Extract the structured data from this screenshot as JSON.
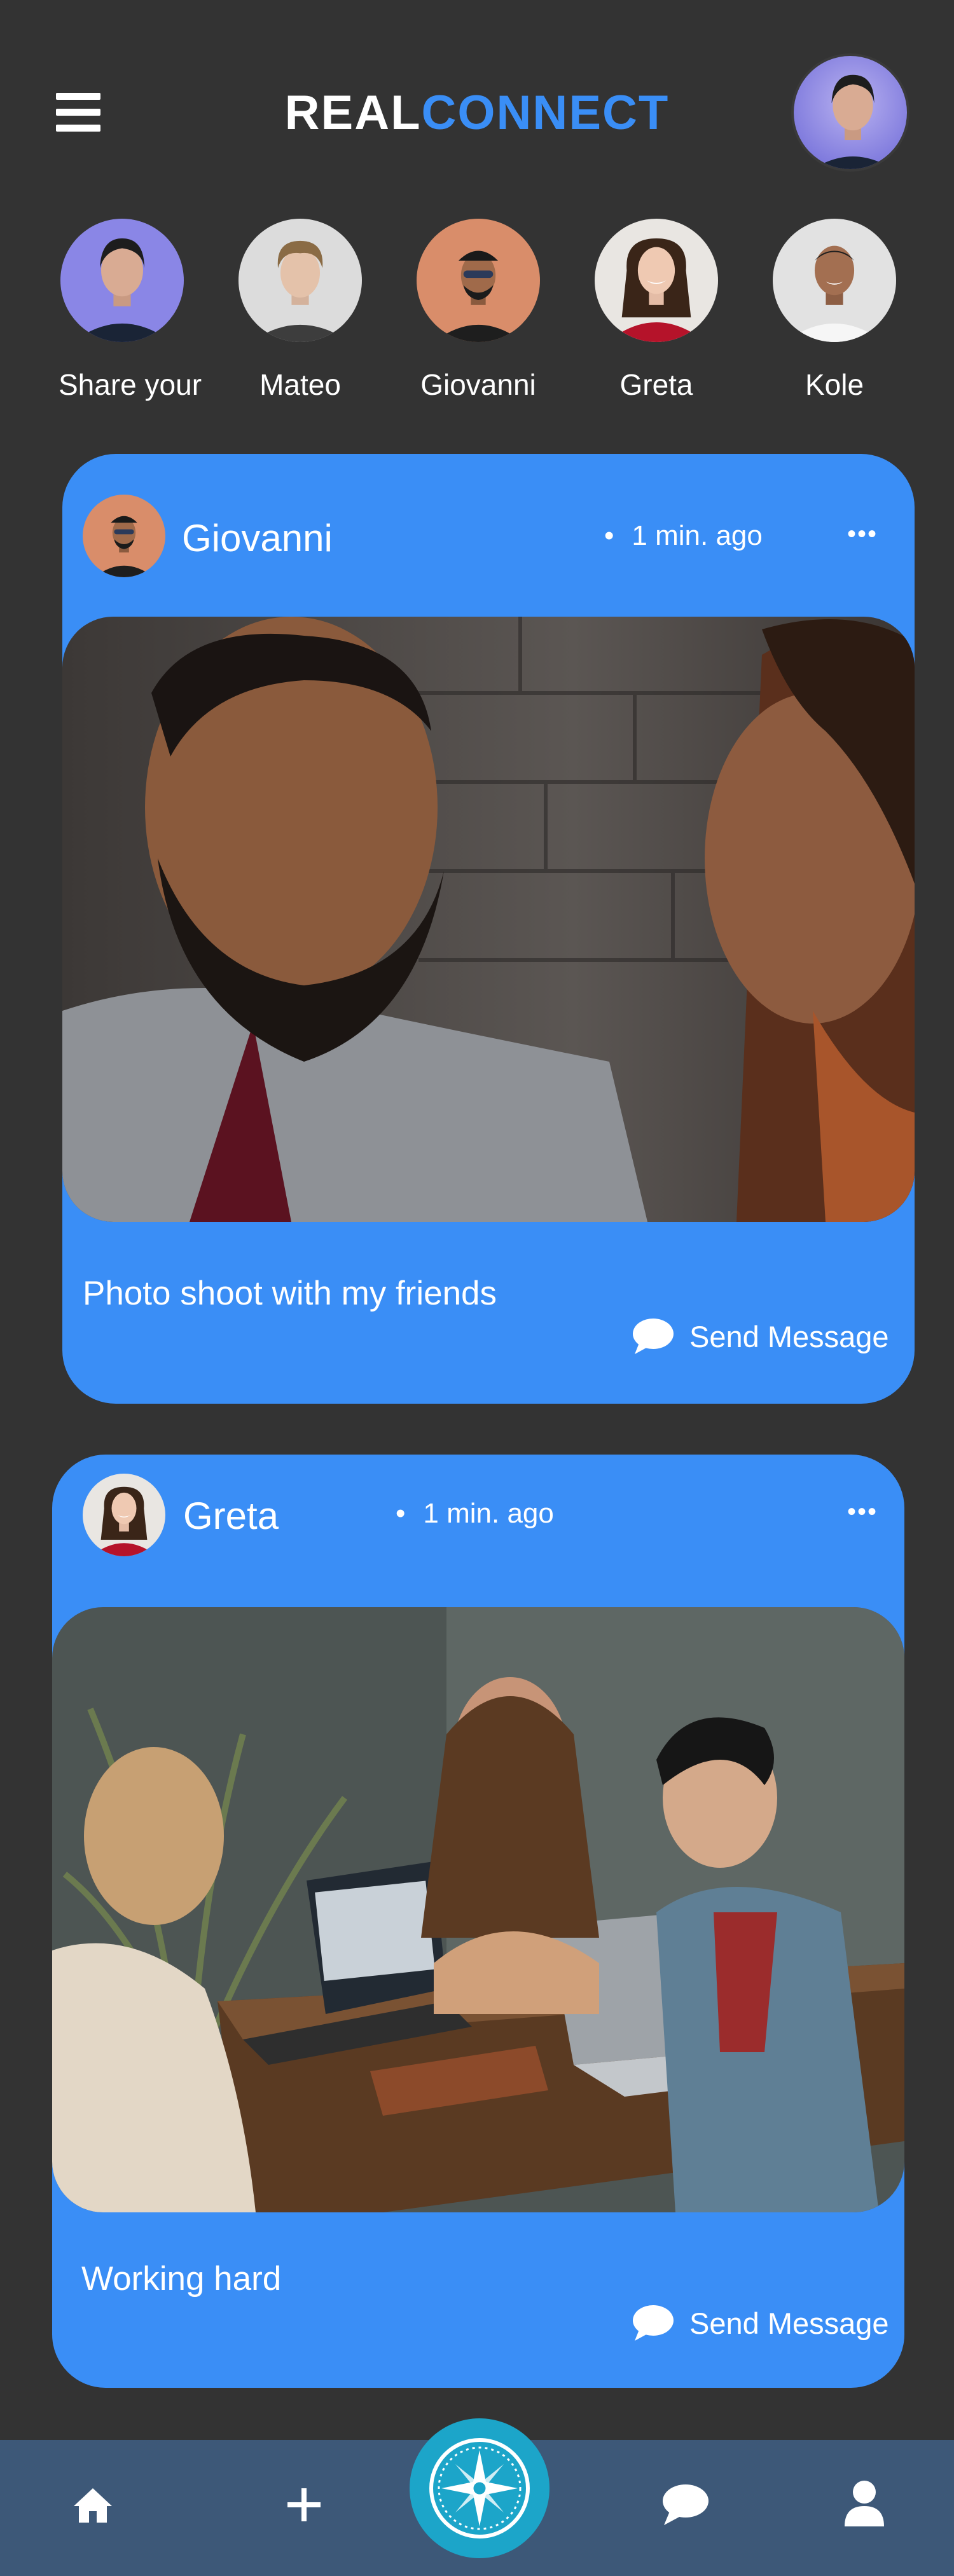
{
  "header": {
    "logo_part1": "REAL",
    "logo_part2": "CONNECT",
    "menu_icon": "hamburger-menu-icon",
    "profile_icon": "user-avatar"
  },
  "stories": [
    {
      "label": "Share your"
    },
    {
      "label": "Mateo"
    },
    {
      "label": "Giovanni"
    },
    {
      "label": "Greta"
    },
    {
      "label": "Kole"
    }
  ],
  "posts": [
    {
      "author": "Giovanni",
      "time": "1 min. ago",
      "more": "•••",
      "caption": "Photo shoot with my friends",
      "send_label": "Send Message"
    },
    {
      "author": "Greta",
      "time": "1 min. ago",
      "more": "•••",
      "caption": "Working hard",
      "send_label": "Send Message"
    }
  ],
  "bottom_nav": {
    "items": [
      "home-icon",
      "plus-icon",
      "compass-icon",
      "chat-bubble-icon",
      "user-icon"
    ]
  },
  "colors": {
    "background": "#333333",
    "accent": "#3a8ef6",
    "nav_bar": "#3d5878",
    "compass": "#1ca5c9"
  }
}
